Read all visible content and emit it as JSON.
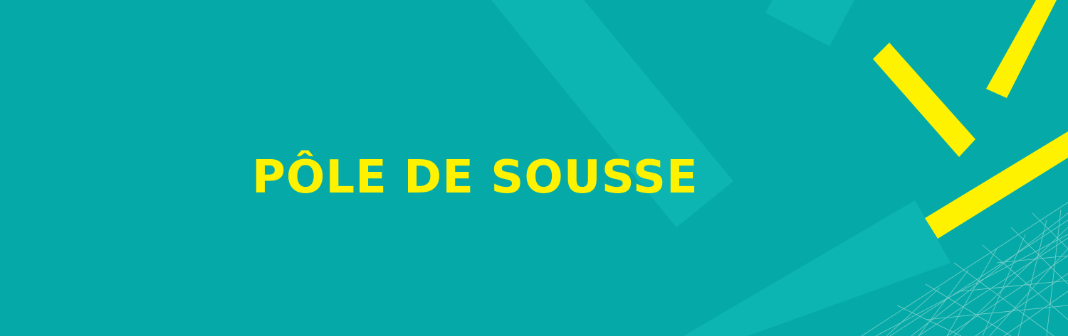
{
  "banner": {
    "title": "PÔLE DE SOUSSE"
  },
  "colors": {
    "background": "#05aaa8",
    "accent": "#fff200",
    "light_band": "#0db5b2",
    "mesh_lines": "#8fd6d1"
  }
}
